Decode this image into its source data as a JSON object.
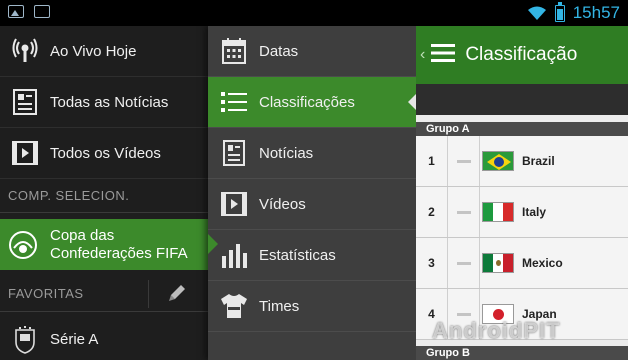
{
  "status_bar": {
    "time": "15h57"
  },
  "left_menu": {
    "items": [
      {
        "label": "Ao Vivo Hoje",
        "icon": "live-broadcast-icon"
      },
      {
        "label": "Todas as Notícias",
        "icon": "news-icon"
      },
      {
        "label": "Todos os Vídeos",
        "icon": "video-icon"
      }
    ],
    "section_selected": "COMP. SELECION.",
    "selected_competition": {
      "line1": "Copa das",
      "line2": "Confederações FIFA",
      "icon": "confederations-cup-logo"
    },
    "section_favorites": "FAVORITAS",
    "favorites": [
      {
        "label": "Série A",
        "icon": "cbf-crest-logo"
      }
    ]
  },
  "middle_menu": {
    "items": [
      {
        "label": "Datas",
        "icon": "calendar-icon"
      },
      {
        "label": "Classificações",
        "icon": "list-icon",
        "active": true
      },
      {
        "label": "Notícias",
        "icon": "news-icon"
      },
      {
        "label": "Vídeos",
        "icon": "video-icon"
      },
      {
        "label": "Estatísticas",
        "icon": "bar-chart-icon"
      },
      {
        "label": "Times",
        "icon": "jersey-icon"
      }
    ]
  },
  "standings": {
    "title": "Classificação",
    "group_a": "Grupo A",
    "group_b": "Grupo B",
    "rows": [
      {
        "pos": "1",
        "team": "Brazil"
      },
      {
        "pos": "2",
        "team": "Italy"
      },
      {
        "pos": "3",
        "team": "Mexico"
      },
      {
        "pos": "4",
        "team": "Japan"
      }
    ]
  },
  "watermark": "AndroidPIT",
  "colors": {
    "accent_green": "#3c8a2b",
    "action_bar_green": "#2f7d23",
    "status_blue": "#33b5e5"
  }
}
